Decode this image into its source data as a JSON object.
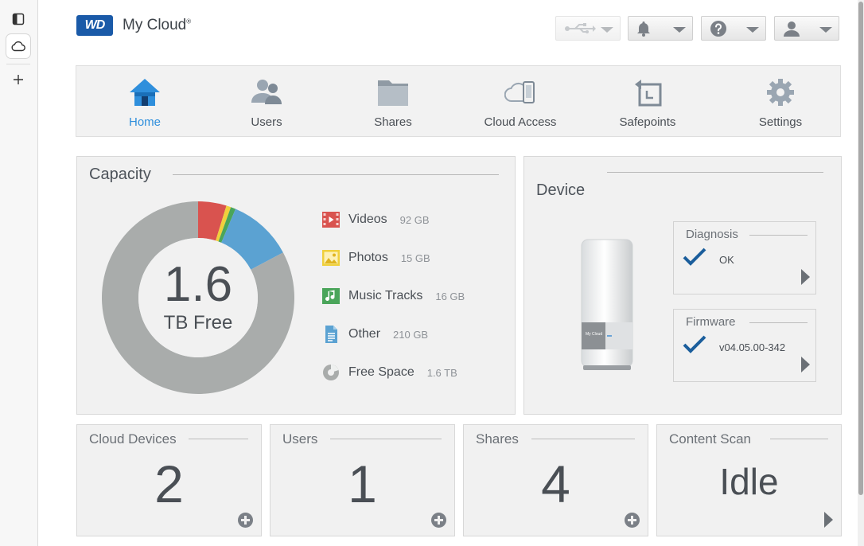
{
  "brand": {
    "logo_text": "WD",
    "app_name": "My Cloud"
  },
  "topbar": {
    "usb": "usb-icon",
    "notifications": "bell-icon",
    "help": "help-icon",
    "account": "user-icon"
  },
  "nav": [
    {
      "label": "Home",
      "icon": "home-icon",
      "active": true
    },
    {
      "label": "Users",
      "icon": "users-icon"
    },
    {
      "label": "Shares",
      "icon": "folder-icon"
    },
    {
      "label": "Cloud Access",
      "icon": "cloud-device-icon"
    },
    {
      "label": "Safepoints",
      "icon": "safepoint-icon"
    },
    {
      "label": "Settings",
      "icon": "gear-icon"
    }
  ],
  "capacity": {
    "title": "Capacity",
    "free_value": "1.6",
    "free_unit": "TB Free",
    "colors": {
      "videos": "#d9534f",
      "photos": "#f0d03c",
      "music": "#4aa55a",
      "other": "#5ba2d2",
      "free": "#a9acab"
    },
    "legend": [
      {
        "name": "Videos",
        "value": "92 GB"
      },
      {
        "name": "Photos",
        "value": "15 GB"
      },
      {
        "name": "Music Tracks",
        "value": "16 GB"
      },
      {
        "name": "Other",
        "value": "210 GB"
      },
      {
        "name": "Free Space",
        "value": "1.6 TB"
      }
    ]
  },
  "device": {
    "title": "Device",
    "product_label": "My Cloud",
    "diagnosis": {
      "title": "Diagnosis",
      "value": "OK"
    },
    "firmware": {
      "title": "Firmware",
      "value": "v04.05.00-342"
    }
  },
  "stats": [
    {
      "title": "Cloud Devices",
      "value": "2"
    },
    {
      "title": "Users",
      "value": "1"
    },
    {
      "title": "Shares",
      "value": "4"
    },
    {
      "title": "Content Scan",
      "value": "Idle"
    }
  ]
}
